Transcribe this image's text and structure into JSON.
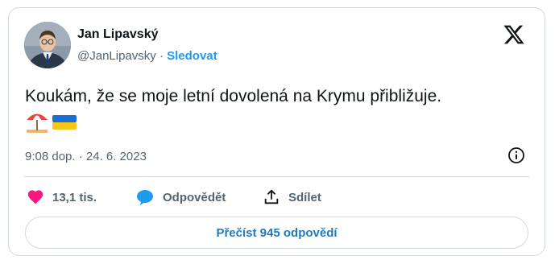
{
  "author": {
    "name": "Jan Lipavský",
    "handle": "@JanLipavsky",
    "separator": "·",
    "follow_label": "Sledovat"
  },
  "tweet": {
    "text": "Koukám, že se moje letní dovolená na Krymu přibližuje.",
    "emojis": [
      "beach-umbrella",
      "ukraine-flag"
    ],
    "timestamp": "9:08 dop. · 24. 6. 2023"
  },
  "actions": {
    "likes": "13,1 tis.",
    "reply_label": "Odpovědět",
    "share_label": "Sdílet"
  },
  "read_replies_label": "Přečíst 945 odpovědí",
  "colors": {
    "accent": "#1d9bf0",
    "like": "#f91880",
    "text": "#0f1419",
    "muted": "#536471",
    "border": "#cfd9de"
  },
  "icons": [
    "x-logo-icon",
    "info-icon",
    "heart-icon",
    "reply-bubble-icon",
    "share-icon"
  ]
}
